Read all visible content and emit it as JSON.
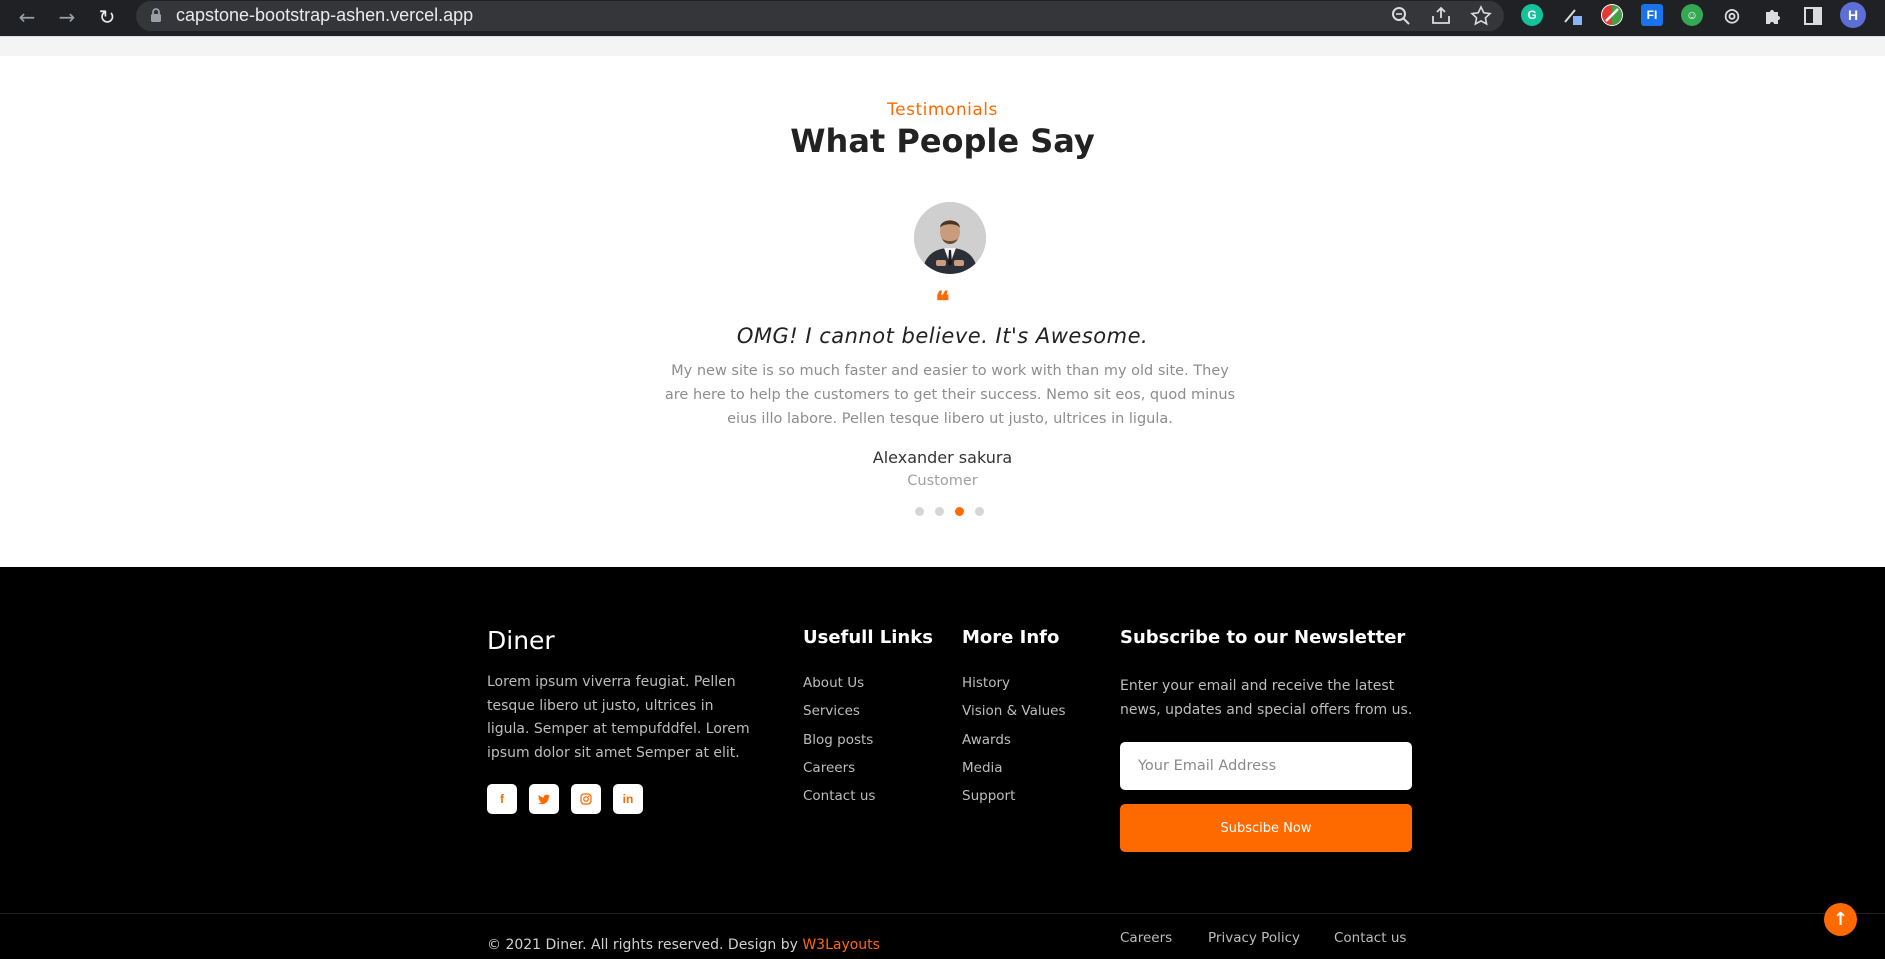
{
  "browser": {
    "url": "capstone-bootstrap-ashen.vercel.app",
    "profile_initial": "H"
  },
  "testimonials": {
    "eyebrow": "Testimonials",
    "heading": "What People Say",
    "quote_title": "OMG! I cannot believe. It's Awesome.",
    "quote_body": "My new site is so much faster and easier to work with than my old site. They are here to help the customers to get their success. Nemo sit eos, quod minus eius illo labore. Pellen tesque libero ut justo, ultrices in ligula.",
    "author": "Alexander sakura",
    "role": "Customer",
    "dots_count": 4,
    "active_dot_index": 2
  },
  "footer": {
    "brand": "Diner",
    "brand_text": "Lorem ipsum viverra feugiat. Pellen tesque libero ut justo, ultrices in ligula. Semper at tempufddfel. Lorem ipsum dolor sit amet Semper at elit.",
    "socials": [
      "facebook-icon",
      "twitter-icon",
      "instagram-icon",
      "linkedin-icon"
    ],
    "useful_links": {
      "title": "Usefull Links",
      "items": [
        "About Us",
        "Services",
        "Blog posts",
        "Careers",
        "Contact us"
      ]
    },
    "more_info": {
      "title": "More Info",
      "items": [
        "History",
        "Vision & Values",
        "Awards",
        "Media",
        "Support"
      ]
    },
    "newsletter": {
      "title": "Subscribe to our Newsletter",
      "text": "Enter your email and receive the latest news, updates and special offers from us.",
      "placeholder": "Your Email Address",
      "button": "Subscibe Now"
    },
    "copyright_prefix": "© 2021 Diner. All rights reserved. Design by ",
    "copyright_link": "W3Layouts",
    "bottom_links": [
      "Careers",
      "Privacy Policy",
      "Contact us"
    ]
  },
  "colors": {
    "accent": "#ff6a00",
    "footer_bg": "#000000",
    "chrome_bg": "#202124"
  }
}
